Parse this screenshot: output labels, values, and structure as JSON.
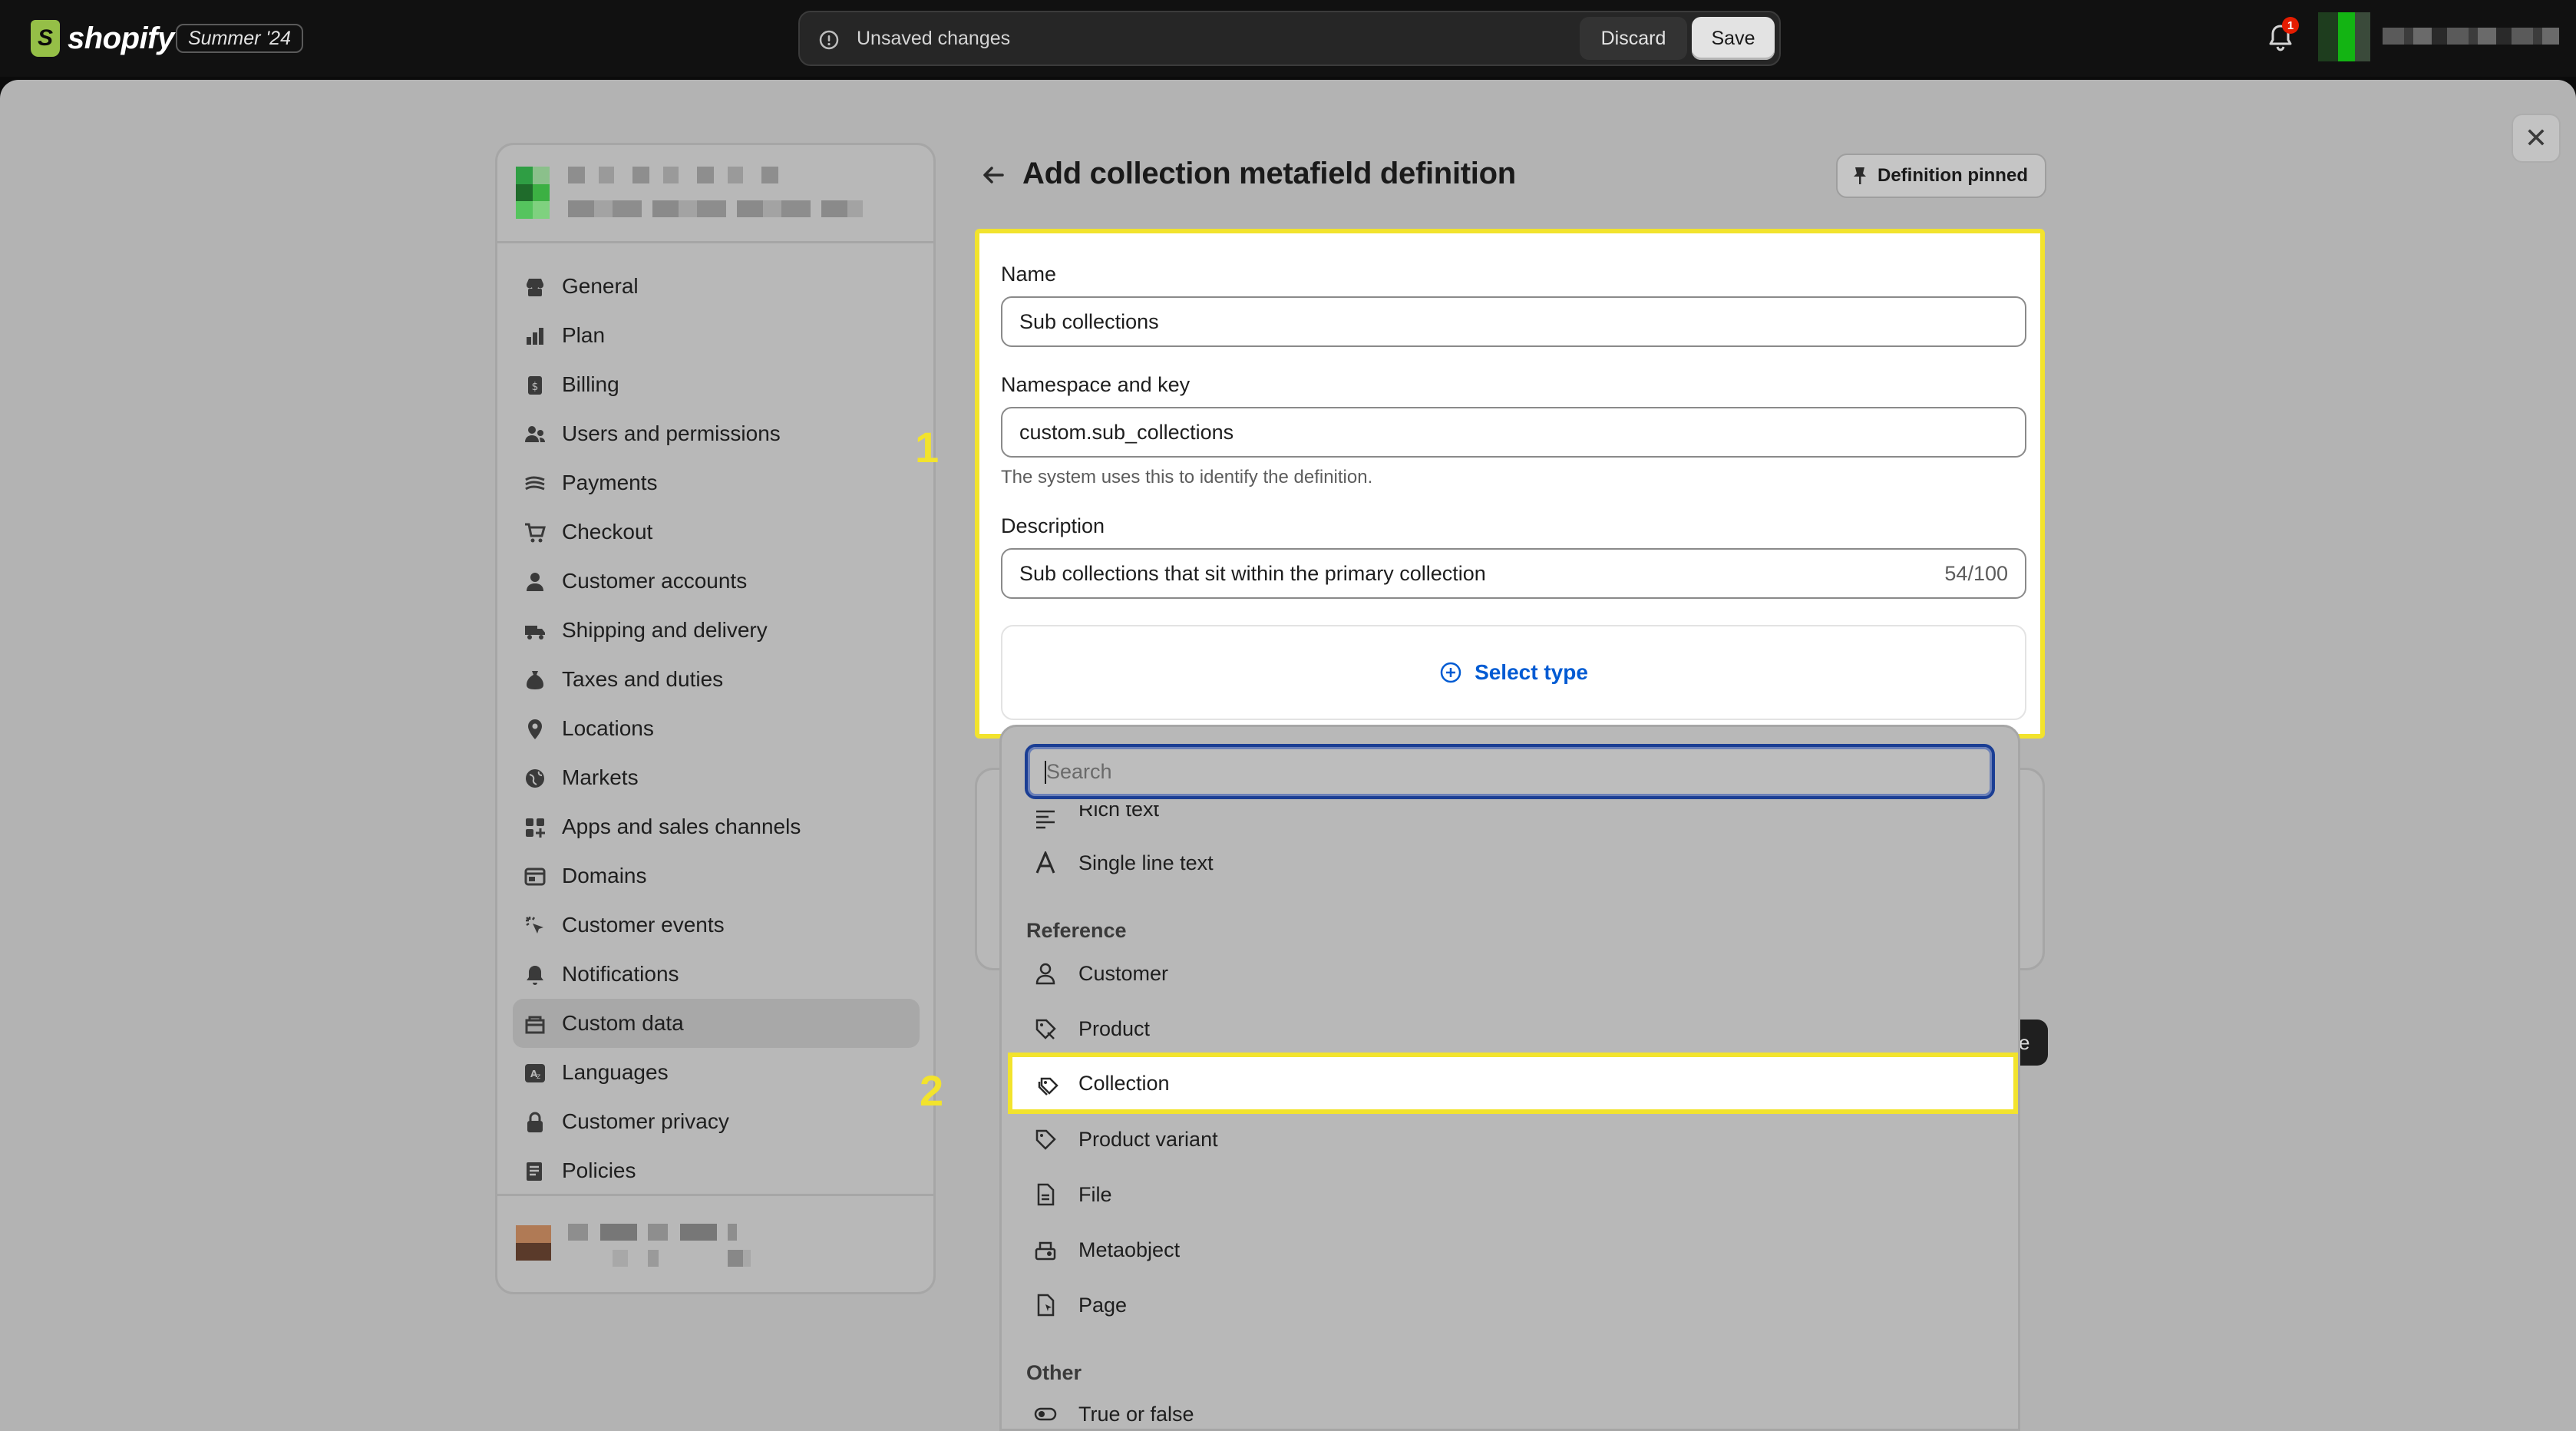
{
  "topbar": {
    "brand": "shopify",
    "edition": "Summer '24",
    "save_bar": {
      "message": "Unsaved changes",
      "discard_label": "Discard",
      "save_label": "Save"
    },
    "notification_count": "1"
  },
  "sidebar": {
    "items": [
      {
        "label": "General",
        "icon": "store-icon"
      },
      {
        "label": "Plan",
        "icon": "plan-icon"
      },
      {
        "label": "Billing",
        "icon": "billing-icon"
      },
      {
        "label": "Users and permissions",
        "icon": "users-icon"
      },
      {
        "label": "Payments",
        "icon": "payments-icon"
      },
      {
        "label": "Checkout",
        "icon": "cart-icon"
      },
      {
        "label": "Customer accounts",
        "icon": "person-icon"
      },
      {
        "label": "Shipping and delivery",
        "icon": "truck-icon"
      },
      {
        "label": "Taxes and duties",
        "icon": "tax-icon"
      },
      {
        "label": "Locations",
        "icon": "location-icon"
      },
      {
        "label": "Markets",
        "icon": "globe-icon"
      },
      {
        "label": "Apps and sales channels",
        "icon": "apps-icon"
      },
      {
        "label": "Domains",
        "icon": "domain-icon"
      },
      {
        "label": "Customer events",
        "icon": "cursor-icon"
      },
      {
        "label": "Notifications",
        "icon": "bell-icon"
      },
      {
        "label": "Custom data",
        "icon": "custom-data-icon",
        "active": true
      },
      {
        "label": "Languages",
        "icon": "language-icon"
      },
      {
        "label": "Customer privacy",
        "icon": "lock-icon"
      },
      {
        "label": "Policies",
        "icon": "policies-icon"
      }
    ]
  },
  "main": {
    "title": "Add collection metafield definition",
    "pin_button_label": "Definition pinned",
    "form": {
      "name_label": "Name",
      "name_value": "Sub collections",
      "namespace_label": "Namespace and key",
      "namespace_value": "custom.sub_collections",
      "namespace_help": "The system uses this to identify the definition.",
      "description_label": "Description",
      "description_value": "Sub collections that sit within the primary collection",
      "description_counter": "54/100",
      "select_type_label": "Select type"
    },
    "step_markers": [
      "1",
      "2"
    ]
  },
  "type_dropdown": {
    "search_placeholder": "Search",
    "items_above": [
      {
        "label": "Rich text",
        "icon": "rich-text-icon"
      },
      {
        "label": "Single line text",
        "icon": "text-icon"
      }
    ],
    "reference_section": "Reference",
    "reference_items": [
      {
        "label": "Customer",
        "icon": "person-icon"
      },
      {
        "label": "Product",
        "icon": "product-tag-icon"
      },
      {
        "label": "Collection",
        "icon": "collection-icon",
        "highlighted": true
      },
      {
        "label": "Product variant",
        "icon": "variant-icon"
      },
      {
        "label": "File",
        "icon": "file-icon"
      },
      {
        "label": "Metaobject",
        "icon": "metaobject-icon"
      },
      {
        "label": "Page",
        "icon": "page-icon"
      }
    ],
    "other_section": "Other",
    "other_items": [
      {
        "label": "True or false",
        "icon": "toggle-icon"
      }
    ]
  },
  "colors": {
    "highlight": "#f2e32d",
    "link": "#005bd3",
    "overlay": "#b3b3b3",
    "topbar": "#111111"
  }
}
